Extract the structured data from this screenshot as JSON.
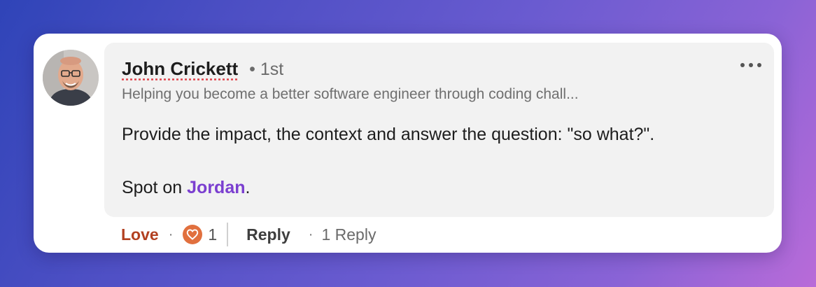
{
  "comment": {
    "author": {
      "name": "John Crickett",
      "degree": "• 1st",
      "headline": "Helping you become a better software engineer through coding chall...",
      "avatar_icon": "profile-photo"
    },
    "body": {
      "line1": "Provide the impact, the context and answer the question: \"so what?\".",
      "line2_prefix": "Spot on ",
      "mention": "Jordan",
      "line2_suffix": "."
    },
    "more_icon": "ellipsis-icon",
    "actions": {
      "love_label": "Love",
      "separator_dot": "·",
      "reaction_icon": "heart-icon",
      "reaction_count": "1",
      "reply_label": "Reply",
      "replies_label": "1 Reply"
    },
    "colors": {
      "love": "#b24020",
      "mention": "#7b3fd0",
      "reaction_badge": "#e1703e"
    }
  }
}
